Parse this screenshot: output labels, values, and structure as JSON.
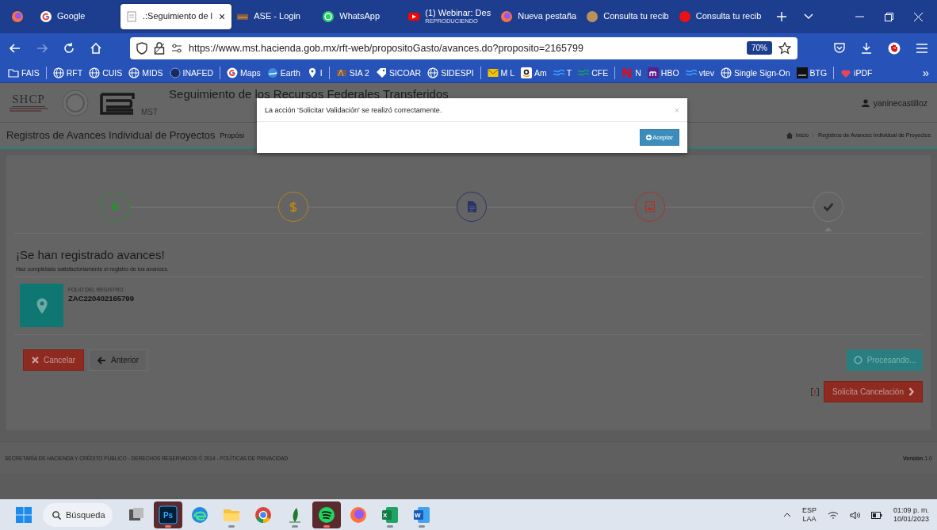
{
  "browser": {
    "tabs": [
      {
        "kind": "google",
        "title": "Google",
        "selected": false
      },
      {
        "kind": "mst",
        "title": ".:Seguimiento de l",
        "close": "×",
        "selected": true
      },
      {
        "kind": "ase",
        "title": "ASE - Login",
        "selected": false
      },
      {
        "kind": "whatsapp",
        "title": "WhatsApp",
        "selected": false
      },
      {
        "kind": "youtube",
        "title": "(1) Webinar: Des",
        "subtitle": "REPRODUCIENDO",
        "selected": false
      },
      {
        "kind": "firefox",
        "title": "Nueva pestaña",
        "selected": false
      },
      {
        "kind": "circle-tan",
        "title": "Consulta tu recib",
        "selected": false
      },
      {
        "kind": "circle-red",
        "title": "Consulta tu recib",
        "selected": false
      }
    ],
    "url": "https://www.mst.hacienda.gob.mx/rft-web/propositoGasto/avances.do?proposito=2165799",
    "zoom": "70%",
    "bookmark_groups": [
      [
        {
          "kind": "folder",
          "label": "FAIS"
        }
      ],
      [
        {
          "kind": "globe",
          "label": "RFT"
        },
        {
          "kind": "globe",
          "label": "CUIS"
        },
        {
          "kind": "globe",
          "label": "MIDS"
        },
        {
          "kind": "seal",
          "label": "INAFED"
        }
      ],
      [
        {
          "kind": "google",
          "label": "Maps"
        },
        {
          "kind": "earth",
          "label": "Earth"
        },
        {
          "kind": "pin",
          "label": "I"
        }
      ],
      [
        {
          "kind": "sia",
          "label": "SIA 2"
        },
        {
          "kind": "tag",
          "label": "SICOAR"
        },
        {
          "kind": "globe",
          "label": "SIDESPI"
        }
      ],
      [
        {
          "kind": "mail",
          "label": "M L"
        },
        {
          "kind": "amazon",
          "label": "Am"
        },
        {
          "kind": "wave",
          "label": "T"
        },
        {
          "kind": "wave-green",
          "label": "CFE"
        }
      ],
      [
        {
          "kind": "netflix",
          "label": "N"
        },
        {
          "kind": "hbo",
          "label": "HBO"
        },
        {
          "kind": "wave",
          "label": "vtev"
        },
        {
          "kind": "globe",
          "label": "Single Sign-On"
        },
        {
          "kind": "btg",
          "label": "BTG"
        }
      ],
      [
        {
          "kind": "pdf",
          "label": "iPDF"
        }
      ]
    ],
    "bookmarks_overflow": "»"
  },
  "page": {
    "header": {
      "logo": "SHCP",
      "app_logo": "MST",
      "title": "Seguimiento de los Recursos Federales Transferidos",
      "user": "yaninecastilloz"
    },
    "subheader": {
      "title": "Registros de Avances Individual de Proyectos",
      "subtitle": "Propósi",
      "breadcrumb": [
        "Inicio",
        "Registros de Avances Individual de Proyectos"
      ]
    },
    "steps": [
      {
        "kind": "location",
        "color": "#2e8b3a",
        "current": false
      },
      {
        "kind": "money",
        "color": "#b5841a",
        "current": false
      },
      {
        "kind": "document",
        "color": "#27346e",
        "current": false
      },
      {
        "kind": "image",
        "color": "#a8352d",
        "current": false
      },
      {
        "kind": "check",
        "color": "#7c7c7c",
        "current": true
      }
    ],
    "success_title": "¡Se han registrado avances!",
    "success_text": "Haz completado satisfactoriamente el registro de los avances.",
    "folio_label": "FOLIO DEL REGISTRO",
    "folio": "ZAC220402165799",
    "buttons": [
      {
        "kind": "cancel",
        "label": "Cancelar"
      },
      {
        "kind": "back",
        "label": "Anterior"
      },
      {
        "kind": "processing",
        "label": "Procesando..."
      },
      {
        "kind": "request",
        "label": "Solicita Cancelación"
      }
    ],
    "footer": {
      "text": "SECRETARÍA DE HACIENDA Y CRÉDITO PÚBLICO - DERECHOS RESERVADOS © 2014 - POLÍTICAS DE PRIVACIDAD",
      "version": "**Versión** 1.0"
    }
  },
  "modal": {
    "message": "La acción 'Solicitar Validación' se realizó correctamente.",
    "close": "×",
    "button": "Aceptar"
  },
  "taskbar": {
    "search_placeholder": "Búsqueda",
    "apps": [
      {
        "kind": "taskview",
        "running": false,
        "active": false
      },
      {
        "kind": "photoshop",
        "glyph": "Ps",
        "running": true,
        "active": true
      },
      {
        "kind": "edge",
        "running": false,
        "active": false
      },
      {
        "kind": "explorer",
        "running": true,
        "active": false
      },
      {
        "kind": "chrome",
        "running": false,
        "active": false
      },
      {
        "kind": "plant",
        "running": true,
        "active": false
      },
      {
        "kind": "spotify",
        "running": true,
        "active": true
      },
      {
        "kind": "firefox",
        "running": false,
        "active": false
      },
      {
        "kind": "excel",
        "glyph": "X",
        "running": true,
        "active": false
      },
      {
        "kind": "word",
        "glyph": "W",
        "running": true,
        "active": false
      }
    ],
    "language": "ESP",
    "layout": "LAA",
    "time": "01:09 p. m.",
    "date": "10/01/2023"
  }
}
